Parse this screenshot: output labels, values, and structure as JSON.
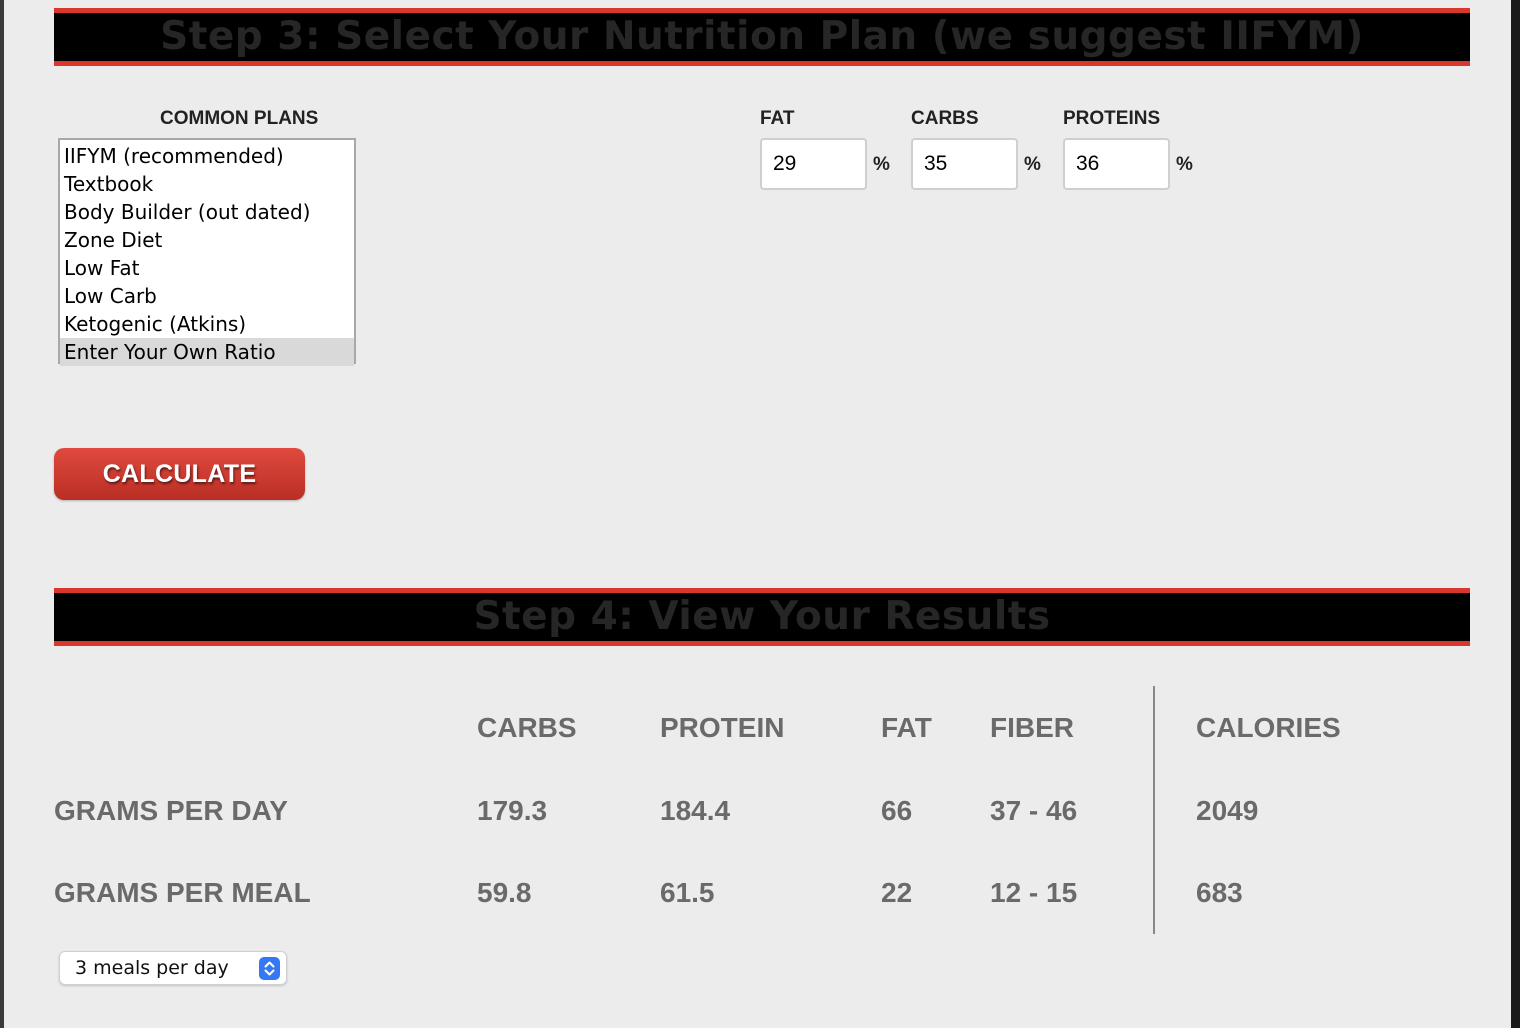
{
  "step3": {
    "title": "Step 3: Select Your Nutrition Plan (we suggest IIFYM)"
  },
  "plans": {
    "label": "COMMON PLANS",
    "items": [
      "IIFYM (recommended)",
      "Textbook",
      "Body Builder (out dated)",
      "Zone Diet",
      "Low Fat",
      "Low Carb",
      "Ketogenic (Atkins)",
      "Enter Your Own Ratio"
    ],
    "selected": "Enter Your Own Ratio"
  },
  "ratios": {
    "fat": {
      "label": "FAT",
      "value": "29",
      "unit": "%"
    },
    "carbs": {
      "label": "CARBS",
      "value": "35",
      "unit": "%"
    },
    "proteins": {
      "label": "PROTEINS",
      "value": "36",
      "unit": "%"
    }
  },
  "calculate_label": "CALCULATE",
  "step4": {
    "title": "Step 4: View Your Results"
  },
  "results": {
    "headers": {
      "carbs": "CARBS",
      "protein": "PROTEIN",
      "fat": "FAT",
      "fiber": "FIBER",
      "calories": "CALORIES"
    },
    "rows": [
      {
        "label": "GRAMS PER DAY",
        "carbs": "179.3",
        "protein": "184.4",
        "fat": "66",
        "fiber": "37 - 46",
        "calories": "2049"
      },
      {
        "label": "GRAMS PER MEAL",
        "carbs": "59.8",
        "protein": "61.5",
        "fat": "22",
        "fiber": "12 - 15",
        "calories": "683"
      }
    ]
  },
  "meals": {
    "selected": "3 meals per day",
    "icon": "stepper-chevrons-icon"
  },
  "colors": {
    "accent_red": "#d9372b",
    "banner_bg": "#000000",
    "result_text": "#6a6a6a",
    "select_accent": "#3478f6"
  }
}
